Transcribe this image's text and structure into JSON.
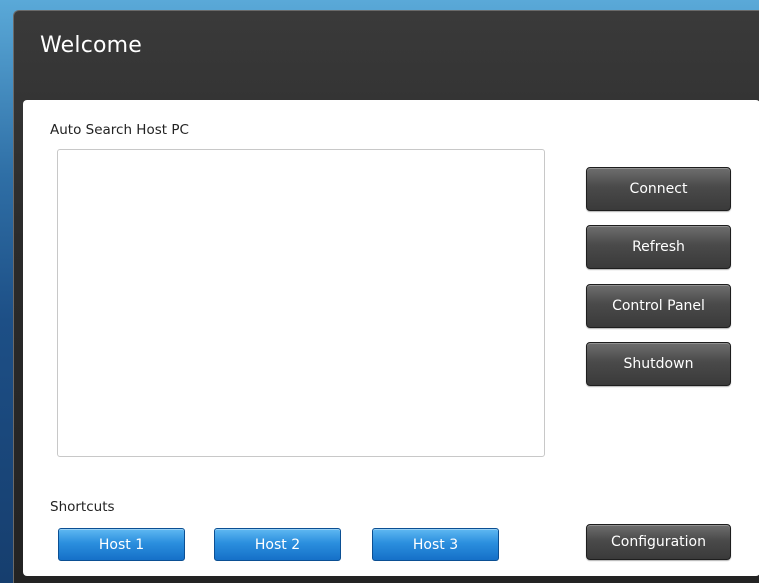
{
  "window": {
    "title": "Welcome"
  },
  "search": {
    "label": "Auto Search Host PC",
    "hosts": []
  },
  "actions": {
    "connect": "Connect",
    "refresh": "Refresh",
    "control_panel": "Control Panel",
    "shutdown": "Shutdown",
    "configuration": "Configuration"
  },
  "shortcuts": {
    "label": "Shortcuts",
    "items": [
      {
        "label": "Host 1"
      },
      {
        "label": "Host 2"
      },
      {
        "label": "Host 3"
      }
    ]
  },
  "colors": {
    "title_bar": "#2b2b2b",
    "dark_button": "#4a4a4a",
    "shortcut_button": "#2b8fde",
    "panel": "#ffffff"
  }
}
